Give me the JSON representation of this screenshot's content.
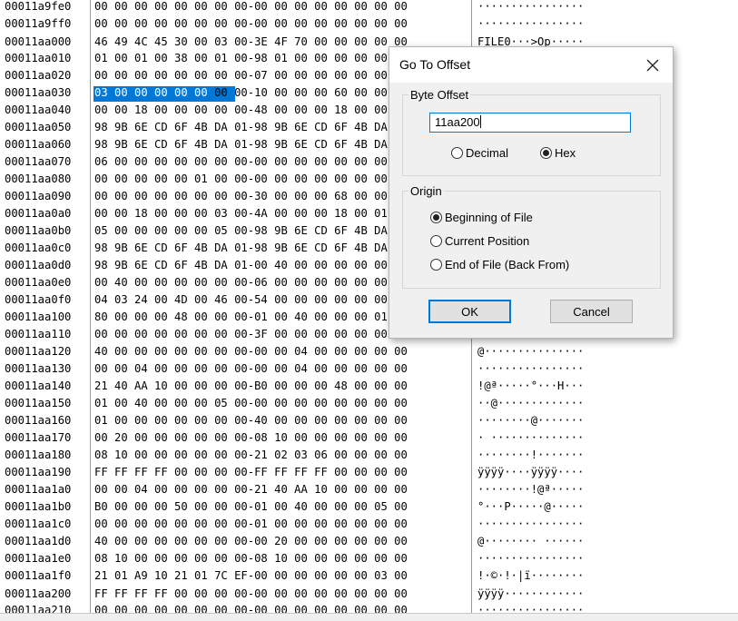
{
  "hex_editor": {
    "rows": [
      {
        "addr": "00011a9fe0",
        "hex": "00 00 00 00 00 00 00 00-00 00 00 00 00 00 00 00",
        "txt": "················"
      },
      {
        "addr": "00011a9ff0",
        "hex": "00 00 00 00 00 00 00 00-00 00 00 00 00 00 00 00",
        "txt": "················"
      },
      {
        "addr": "00011aa000",
        "hex": "46 49 4C 45 30 00 03 00-3E 4F 70 00 00 00 00 00",
        "txt": "FILE0···>Op·····"
      },
      {
        "addr": "00011aa010",
        "hex": "01 00 01 00 38 00 01 00-98 01 00 00 00 00 00 00",
        "txt": ""
      },
      {
        "addr": "00011aa020",
        "hex": "00 00 00 00 00 00 00 00-07 00 00 00 00 00 00 00",
        "txt": ""
      },
      {
        "addr": "00011aa030",
        "hex_sel": "03 00 00 00 00 00",
        "hex": " 00 00-10 00 00 00 60 00 00 00",
        "txt": ""
      },
      {
        "addr": "00011aa040",
        "hex": "00 00 18 00 00 00 00 00-48 00 00 00 18 00 00 00",
        "txt": ""
      },
      {
        "addr": "00011aa050",
        "hex": "98 9B 6E CD 6F 4B DA 01-98 9B 6E CD 6F 4B DA 01",
        "txt": ""
      },
      {
        "addr": "00011aa060",
        "hex": "98 9B 6E CD 6F 4B DA 01-98 9B 6E CD 6F 4B DA 01",
        "txt": ""
      },
      {
        "addr": "00011aa070",
        "hex": "06 00 00 00 00 00 00 00-00 00 00 00 00 00 00 00",
        "txt": ""
      },
      {
        "addr": "00011aa080",
        "hex": "00 00 00 00 00 01 00 00-00 00 00 00 00 00 00 00",
        "txt": ""
      },
      {
        "addr": "00011aa090",
        "hex": "00 00 00 00 00 00 00 00-30 00 00 00 68 00 00 00",
        "txt": ""
      },
      {
        "addr": "00011aa0a0",
        "hex": "00 00 18 00 00 00 03 00-4A 00 00 00 18 00 01 00",
        "txt": ""
      },
      {
        "addr": "00011aa0b0",
        "hex": "05 00 00 00 00 00 05 00-98 9B 6E CD 6F 4B DA 01",
        "txt": ""
      },
      {
        "addr": "00011aa0c0",
        "hex": "98 9B 6E CD 6F 4B DA 01-98 9B 6E CD 6F 4B DA 01",
        "txt": ""
      },
      {
        "addr": "00011aa0d0",
        "hex": "98 9B 6E CD 6F 4B DA 01-00 40 00 00 00 00 00 00",
        "txt": ""
      },
      {
        "addr": "00011aa0e0",
        "hex": "00 40 00 00 00 00 00 00-06 00 00 00 00 00 00 00",
        "txt": ""
      },
      {
        "addr": "00011aa0f0",
        "hex": "04 03 24 00 4D 00 46 00-54 00 00 00 00 00 00 00",
        "txt": ""
      },
      {
        "addr": "00011aa100",
        "hex": "80 00 00 00 48 00 00 00-01 00 40 00 00 00 01 00",
        "txt": ""
      },
      {
        "addr": "00011aa110",
        "hex": "00 00 00 00 00 00 00 00-3F 00 00 00 00 00 00 00",
        "txt": ""
      },
      {
        "addr": "00011aa120",
        "hex": "40 00 00 00 00 00 00 00-00 00 04 00 00 00 00 00",
        "txt": "@···············"
      },
      {
        "addr": "00011aa130",
        "hex": "00 00 04 00 00 00 00 00-00 00 04 00 00 00 00 00",
        "txt": "················"
      },
      {
        "addr": "00011aa140",
        "hex": "21 40 AA 10 00 00 00 00-B0 00 00 00 48 00 00 00",
        "txt": "!@ª·····°···H···"
      },
      {
        "addr": "00011aa150",
        "hex": "01 00 40 00 00 00 05 00-00 00 00 00 00 00 00 00",
        "txt": "··@·············"
      },
      {
        "addr": "00011aa160",
        "hex": "01 00 00 00 00 00 00 00-40 00 00 00 00 00 00 00",
        "txt": "········@·······"
      },
      {
        "addr": "00011aa170",
        "hex": "00 20 00 00 00 00 00 00-08 10 00 00 00 00 00 00",
        "txt": "· ··············"
      },
      {
        "addr": "00011aa180",
        "hex": "08 10 00 00 00 00 00 00-21 02 03 06 00 00 00 00",
        "txt": "········!·······"
      },
      {
        "addr": "00011aa190",
        "hex": "FF FF FF FF 00 00 00 00-FF FF FF FF 00 00 00 00",
        "txt": "ÿÿÿÿ····ÿÿÿÿ····"
      },
      {
        "addr": "00011aa1a0",
        "hex": "00 00 04 00 00 00 00 00-21 40 AA 10 00 00 00 00",
        "txt": "········!@ª·····"
      },
      {
        "addr": "00011aa1b0",
        "hex": "B0 00 00 00 50 00 00 00-01 00 40 00 00 00 05 00",
        "txt": "°···P·····@·····"
      },
      {
        "addr": "00011aa1c0",
        "hex": "00 00 00 00 00 00 00 00-01 00 00 00 00 00 00 00",
        "txt": "················"
      },
      {
        "addr": "00011aa1d0",
        "hex": "40 00 00 00 00 00 00 00-00 20 00 00 00 00 00 00",
        "txt": "@········ ······"
      },
      {
        "addr": "00011aa1e0",
        "hex": "08 10 00 00 00 00 00 00-08 10 00 00 00 00 00 00",
        "txt": "················"
      },
      {
        "addr": "00011aa1f0",
        "hex": "21 01 A9 10 21 01 7C EF-00 00 00 00 00 00 03 00",
        "txt": "!·©·!·|ï········"
      },
      {
        "addr": "00011aa200",
        "hex": "FF FF FF FF 00 00 00 00-00 00 00 00 00 00 00 00",
        "txt": "ÿÿÿÿ············"
      },
      {
        "addr": "00011aa210",
        "hex": "00 00 00 00 00 00 00 00-00 00 00 00 00 00 00 00",
        "txt": "················"
      }
    ]
  },
  "dialog": {
    "title": "Go To Offset",
    "byte_offset_group": "Byte Offset",
    "offset_value": "11aa200",
    "decimal_label": "Decimal",
    "hex_label": "Hex",
    "selected_base": "Hex",
    "origin_group": "Origin",
    "beginning_label": "Beginning of File",
    "current_label": "Current Position",
    "end_label": "End of File (Back From)",
    "selected_origin": "Beginning of File",
    "ok_label": "OK",
    "cancel_label": "Cancel"
  }
}
